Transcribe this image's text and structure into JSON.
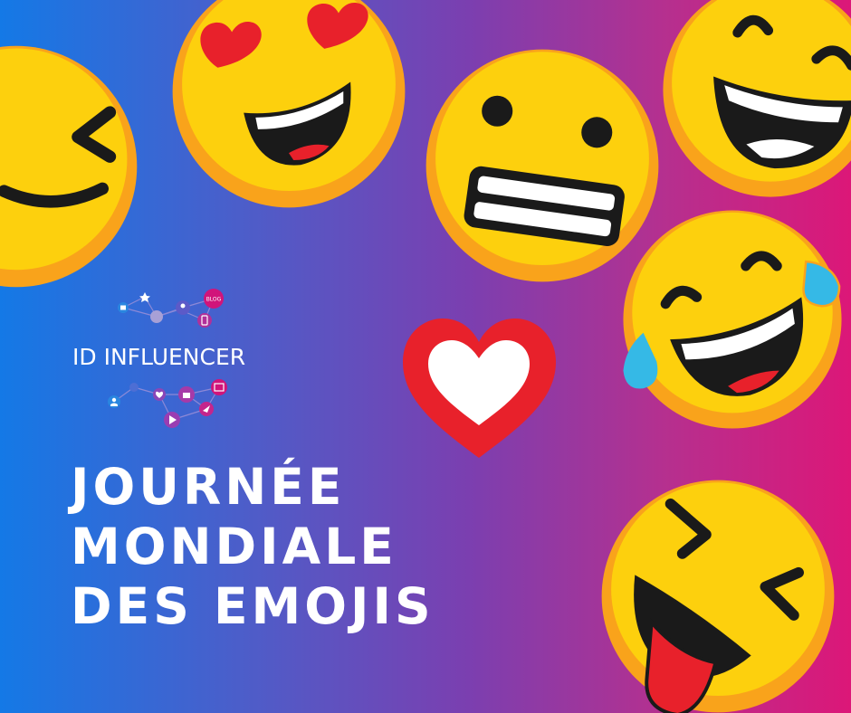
{
  "logo": {
    "brand": "ID INFLUENCER",
    "badge": "BLOG"
  },
  "headline": {
    "line1": "JOURNÉE",
    "line2": "MONDIALE",
    "line3": "DES EMOJIS"
  },
  "colors": {
    "gradient_left": "#1479e6",
    "gradient_right": "#dc1778",
    "emoji_face": "#fdd00d",
    "emoji_rim": "#f9a31b",
    "heart_red": "#e8212b",
    "tear_blue": "#35b9e6"
  },
  "icons": [
    "winking-face-emoji",
    "heart-eyes-emoji",
    "grimacing-face-emoji",
    "grinning-face-emoji",
    "tears-of-joy-emoji",
    "tongue-out-emoji",
    "heart-icon",
    "network-logo-icon"
  ]
}
